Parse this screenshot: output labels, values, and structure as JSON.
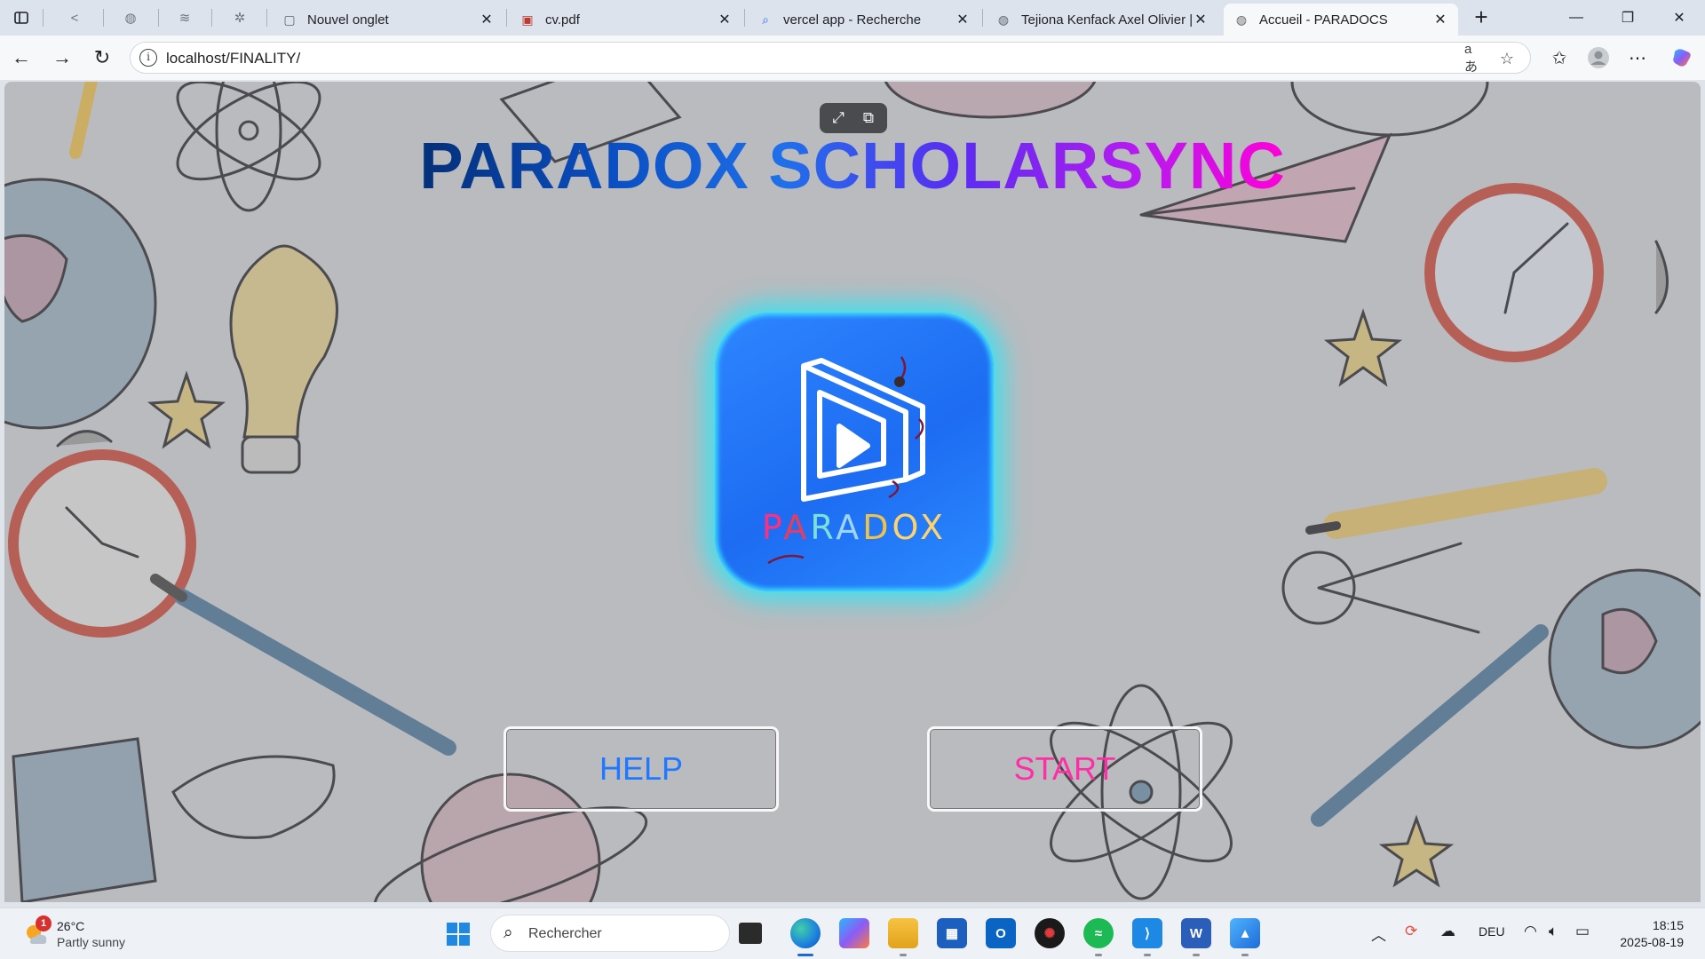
{
  "browser": {
    "tabs": [
      {
        "title": "Nouvel onglet",
        "icon": "blank-page-icon",
        "active": false
      },
      {
        "title": "cv.pdf",
        "icon": "pdf-icon",
        "active": false
      },
      {
        "title": "vercel app - Recherche",
        "icon": "search-icon",
        "active": false
      },
      {
        "title": "Tejiona Kenfack Axel Olivier |",
        "icon": "globe-icon",
        "active": false
      },
      {
        "title": "Accueil - PARADOCS",
        "icon": "globe-icon",
        "active": true
      }
    ],
    "tab_close": "✕",
    "new_tab": "+",
    "url": "localhost/FINALITY/",
    "window_controls": {
      "minimize": "—",
      "restore": "❐",
      "close": "✕"
    }
  },
  "page": {
    "title": "PARADOX SCHOLARSYNC",
    "logo_word": [
      "P",
      "A",
      "R",
      "A",
      "D",
      "O",
      "X"
    ],
    "buttons": {
      "help": "HELP",
      "start": "START"
    }
  },
  "taskbar": {
    "weather": {
      "temp": "26°C",
      "desc": "Partly sunny",
      "badge": "1"
    },
    "search_placeholder": "Rechercher",
    "language": "DEU",
    "time": "18:15",
    "date": "2025-08-19"
  },
  "colors": {
    "title_gradient": [
      "#052f78",
      "#1f70ea",
      "#5a2cf2",
      "#ff00d8"
    ],
    "logo_bg": "#1d6cf2",
    "logo_glow": "#3ce0f0",
    "help": "#1f78ff",
    "start": "#ff2ea6"
  }
}
